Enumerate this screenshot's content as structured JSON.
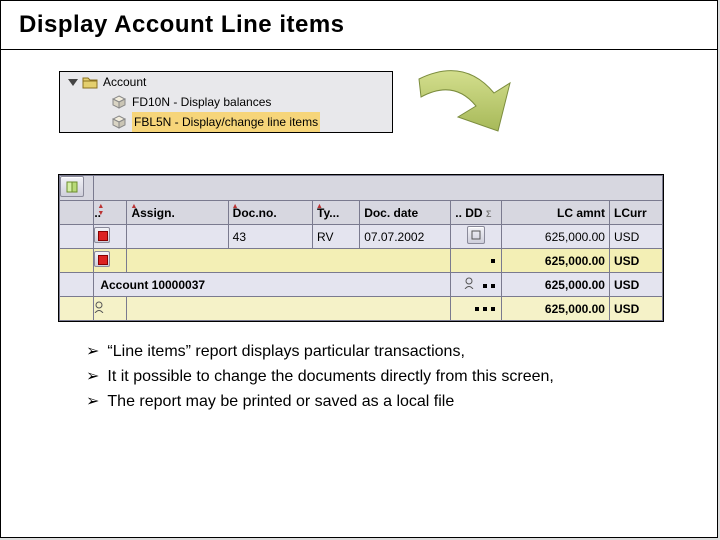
{
  "slide": {
    "title": "Display Account Line items"
  },
  "tree": {
    "root": "Account",
    "child1": "FD10N - Display balances",
    "child2": "FBL5N - Display/change line items"
  },
  "grid": {
    "headers": {
      "assign": "Assign.",
      "docno": "Doc.no.",
      "ty": "Ty...",
      "docdate": "Doc. date",
      "dd": "DD",
      "amount": "LC amnt",
      "curr": "LCurr"
    },
    "row1": {
      "docno": "43",
      "ty": "RV",
      "docdate": "07.07.2002",
      "amount": "625,000.00",
      "curr": "USD"
    },
    "subtotal1": {
      "amount": "625,000.00",
      "curr": "USD"
    },
    "account_row": {
      "label": "Account 10000037",
      "amount": "625,000.00",
      "curr": "USD"
    },
    "subtotal2": {
      "amount": "625,000.00",
      "curr": "USD"
    }
  },
  "bullets": {
    "b1": "“Line items” report displays particular transactions,",
    "b2": "It it possible to change the documents directly from this screen,",
    "b3": "The report may be printed or saved as a local file"
  }
}
